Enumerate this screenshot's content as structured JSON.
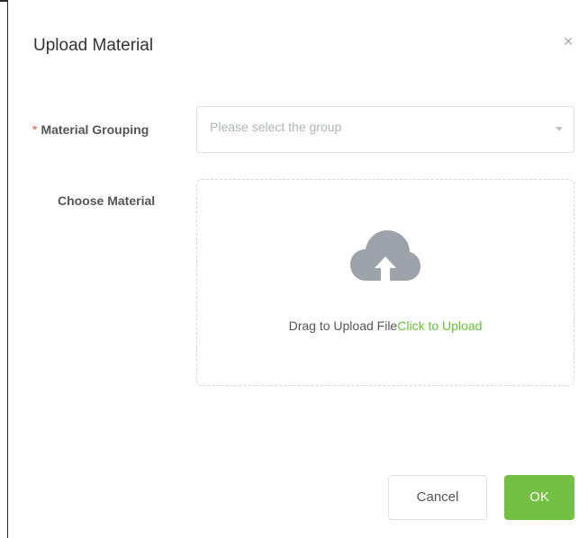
{
  "dialog": {
    "title": "Upload Material",
    "close_symbol": "×"
  },
  "form": {
    "grouping": {
      "required_mark": "*",
      "label": "Material Grouping",
      "placeholder": "Please select the group"
    },
    "material": {
      "label": "Choose Material",
      "drag_text": "Drag to Upload File",
      "click_text": "Click to Upload",
      "icon": "cloud-upload-icon"
    }
  },
  "footer": {
    "cancel_label": "Cancel",
    "ok_label": "OK"
  },
  "colors": {
    "accent": "#74c044",
    "link": "#67c23a",
    "required": "#f05050"
  }
}
